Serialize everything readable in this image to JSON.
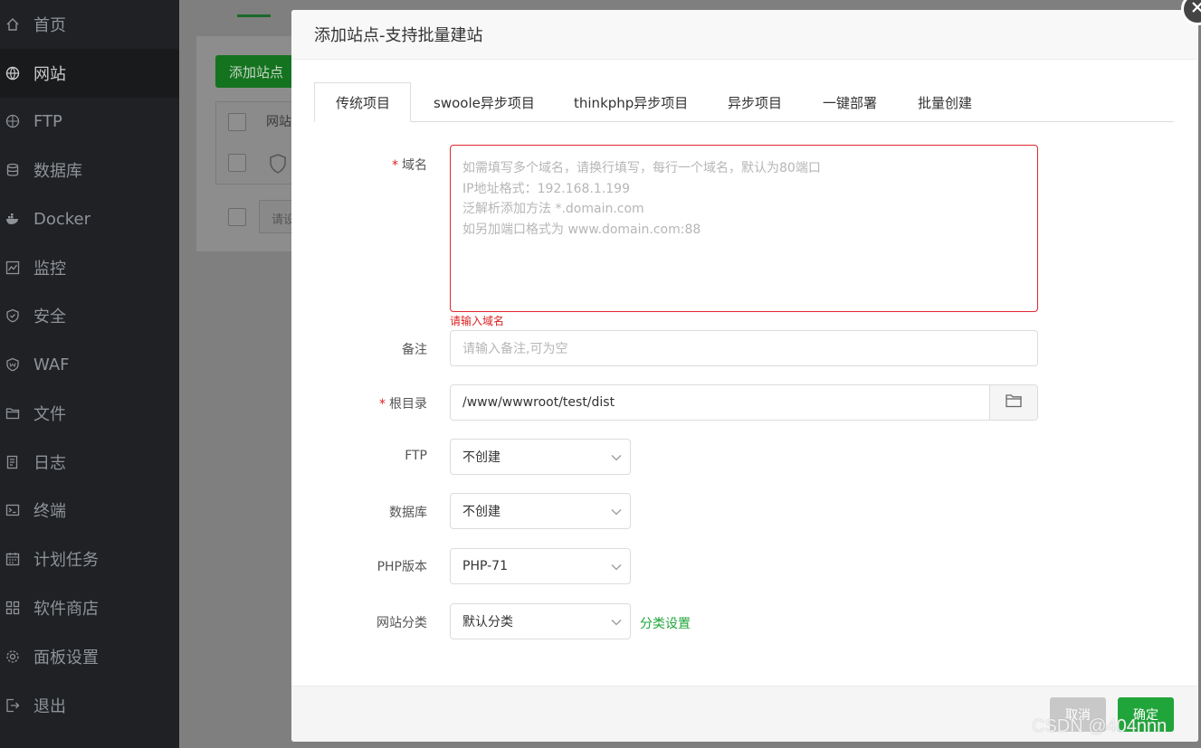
{
  "sidebar": {
    "items": [
      {
        "label": "首页",
        "icon": "home-icon",
        "active": false
      },
      {
        "label": "网站",
        "icon": "globe-icon",
        "active": true
      },
      {
        "label": "FTP",
        "icon": "ftp-icon",
        "active": false
      },
      {
        "label": "数据库",
        "icon": "database-icon",
        "active": false
      },
      {
        "label": "Docker",
        "icon": "docker-icon",
        "active": false
      },
      {
        "label": "监控",
        "icon": "monitor-icon",
        "active": false
      },
      {
        "label": "安全",
        "icon": "shield-icon",
        "active": false
      },
      {
        "label": "WAF",
        "icon": "waf-icon",
        "active": false
      },
      {
        "label": "文件",
        "icon": "folder-icon",
        "active": false
      },
      {
        "label": "日志",
        "icon": "log-icon",
        "active": false
      },
      {
        "label": "终端",
        "icon": "terminal-icon",
        "active": false
      },
      {
        "label": "计划任务",
        "icon": "calendar-icon",
        "active": false
      },
      {
        "label": "软件商店",
        "icon": "apps-icon",
        "active": false
      },
      {
        "label": "面板设置",
        "icon": "gear-icon",
        "active": false
      },
      {
        "label": "退出",
        "icon": "logout-icon",
        "active": false
      }
    ]
  },
  "background": {
    "add_site_button": "添加站点",
    "table_header": "网站",
    "search_placeholder": "请设"
  },
  "modal": {
    "title": "添加站点-支持批量建站",
    "tabs": [
      "传统项目",
      "swoole异步项目",
      "thinkphp异步项目",
      "异步项目",
      "一键部署",
      "批量创建"
    ],
    "active_tab": 0,
    "domain": {
      "label": "域名",
      "placeholder_lines": [
        "如需填写多个域名，请换行填写，每行一个域名，默认为80端口",
        "IP地址格式：192.168.1.199",
        "泛解析添加方法 *.domain.com",
        "如另加端口格式为 www.domain.com:88"
      ],
      "error": "请输入域名"
    },
    "remark": {
      "label": "备注",
      "placeholder": "请输入备注,可为空"
    },
    "root_dir": {
      "label": "根目录",
      "value": "/www/wwwroot/test/dist"
    },
    "ftp": {
      "label": "FTP",
      "value": "不创建"
    },
    "database": {
      "label": "数据库",
      "value": "不创建"
    },
    "php_version": {
      "label": "PHP版本",
      "value": "PHP-71"
    },
    "category": {
      "label": "网站分类",
      "value": "默认分类",
      "settings_link": "分类设置"
    },
    "cancel_label": "取消",
    "confirm_label": "确定"
  },
  "watermark": "CSDN @404nnn",
  "colors": {
    "accent": "#20a53a",
    "error": "#e02020",
    "sidebar_bg": "#1f2124"
  }
}
